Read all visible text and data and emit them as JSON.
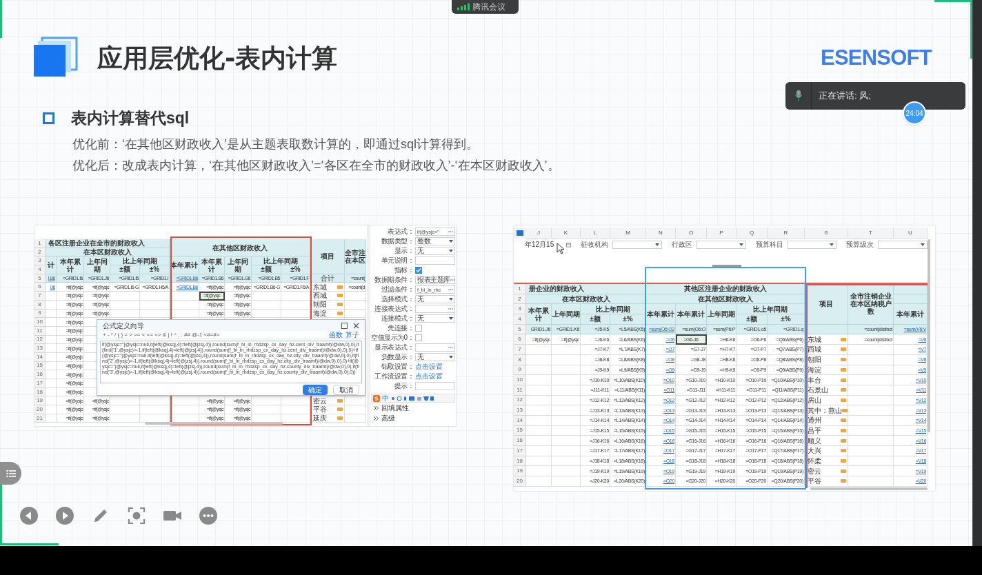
{
  "meeting_badge": {
    "title": "腾讯会议"
  },
  "slide": {
    "title": "应用层优化-表内计算",
    "brand": "ESENSOFT",
    "section": "表内计算替代sql",
    "paragraphs": [
      "优化前：‘在其他区财政收入’是从主题表取数计算的，即通过sql计算得到。",
      "优化后：改成表内计算，‘在其他区财政收入’=‘各区在全市的财政收入’-‘在本区财政收入’。"
    ]
  },
  "left_screenshot": {
    "row_numbers": [
      "1",
      "2",
      "3",
      "4",
      "5",
      "6",
      "7",
      "8",
      "9",
      "10",
      "11",
      "12",
      "13",
      "14",
      "15",
      "16",
      "17",
      "18",
      "19",
      "20",
      "21"
    ],
    "header_cells": [
      {
        "text": "各区注册企业在全市的财政收入"
      },
      {
        "text": "在本区财政收入"
      },
      {
        "text": "在其他区财政收入"
      },
      {
        "text": "项目"
      },
      {
        "lines": [
          "全市注",
          "在本区"
        ]
      },
      {
        "text": "计"
      },
      {
        "text": "本年累计"
      },
      {
        "text": "上年同期"
      },
      {
        "text": "比上年同期"
      },
      {
        "text": "±额"
      },
      {
        "text": "±%"
      },
      {
        "text": "本年累计"
      },
      {
        "text": "本年累计"
      },
      {
        "text": "上年同期"
      },
      {
        "text": "比上年同期"
      },
      {
        "text": "±额"
      },
      {
        "text": "±%"
      }
    ],
    "body_rows": [
      {
        "c1": {
          "text": "I.B6",
          "kind": "link"
        },
        "c2": "=GRID1.I6",
        "c3": "=GRID1.J6",
        "c4": "=GRID1.I5",
        "c5": "=GRID1.I",
        "c6": {
          "text": "=GRID1.B6",
          "kind": "link"
        },
        "c7": "=GRID1.B6",
        "c8": "=GRID1.G6",
        "c9": "=GRID1.B5",
        "c10": "=GRID1.F",
        "c11": "合计",
        "c12": "=count("
      },
      {
        "c1": {
          "text": "I.I6",
          "kind": "link"
        },
        "c2": "=if(@ysjc",
        "c3": "=if(@ysjc",
        "c4": "=GRID1.I6-G",
        "c5": "=GRID1.H5/A",
        "c6": {
          "text": "=GRID1.B6",
          "kind": "link"
        },
        "c7": "=if(@ysjc",
        "c8": "=if(@ysjc",
        "c9": "=GRID1.B6-G",
        "c10": "=GRID1.F6/A",
        "c11": "东城",
        "c12": "=count(d"
      },
      {
        "c2": "=if(@ysjc",
        "c3": "=if(@ysjc",
        "c7": {
          "text": "=if(@ysjc",
          "kind": "selected"
        },
        "c8": "=if(@ysjc",
        "c11": "西城"
      },
      {
        "c2": "=if(@ysjc",
        "c3": "=if(@ysjc",
        "c7": "=if(@ysjc",
        "c8": "=if(@ysjc",
        "c11": "朝阳"
      },
      {
        "c2": "=if(@ysjc",
        "c3": "=if(@ysjc",
        "c7": "=if(@ysjc",
        "c8": "=if(@ysjc",
        "c11": "海淀"
      },
      {
        "c2": "=if(@ysjc"
      },
      {
        "c2": "=if(@ysjc"
      },
      {
        "c2": "=if(@ysjc"
      },
      {
        "c2": "=if(@ysjc"
      },
      {
        "c2": "=if(@ysjc"
      },
      {
        "c2": "=if(@ysjc"
      },
      {
        "c2": "=if(@ysjc"
      },
      {
        "c2": "=if(@ysjc"
      },
      {
        "c2": "=if(@ysjc"
      },
      {
        "c2": "=if(@ysjc",
        "c3": "=if(@ysjc",
        "c7": "=if(@ysjc",
        "c8": "=if(@ysjc",
        "c11": "密云"
      },
      {
        "c2": "=if(@ysjc",
        "c3": "=if(@ysjc",
        "c7": "=if(@ysjc",
        "c8": "=if(@ysjc",
        "c11": "平谷"
      },
      {
        "c2": "=if(@ysjc",
        "c3": "=if(@ysjc",
        "c7": "=if(@ysjc",
        "c8": "=if(@ysjc",
        "c11": "延庆"
      }
    ],
    "dialog": {
      "title": "公式定义向导",
      "operators": "+ - * / ( ) = > >= < <= <> & | ! ^ , : ## @-1 <#=#>",
      "links": [
        "函数",
        "算子"
      ],
      "formula": "if(@ysjc=''|@ysjc=null,if(left(@ksqj,4)=left(@jzsj,4)),round(sum(f_bi_in_rhdzsp_cx_day_hz.cent_div_traamt)/@dw,0),0),if(find('1',@ysjc)>-1,if(left(@ksqj,4)=left(@jzsj,4)),round(sum(f_bi_in_rhdzsp_cx_day_hz.cent_div_traamt)/@dw,0),0),0)+if(@ysjc=''|@ysjc=null,if(left(@ksqj,4)=left(@jzsj,4)),round(sum(f_bi_in_rhdzsp_cx_day_hz.city_div_traamt)/@dw,0),0),if(find('2',@ysjc)>-1,if(left(@ksqj,4)=left(@jzsj,4)),round(sum(f_bi_in_rhdzsp_cx_day_hz.city_div_traamt)/@dw,0),0),0)+if(@ysjc=''|@ysjc=null,if(left(@ksqj,4)=left(@jzsj,4)),round(sum(f_bi_in_rhdzsp_cx_day_hz.county_div_traamt)/@dw,0),0),if(find('3',@ysjc)>-1,if(left(@ksqj,4)=left(@jzsj,4)),round(sum(f_bi_in_rhdzsp_cx_day_hz.county_div_traamt)/@dw,0),0),0))",
      "buttons": [
        {
          "label": "确定",
          "primary": true
        },
        {
          "label": "取消",
          "primary": false
        }
      ]
    },
    "properties": [
      {
        "label": "表达式：",
        "kind": "ellipsis",
        "value": "if(@ysjc=''"
      },
      {
        "label": "数据类型：",
        "kind": "select",
        "value": "整数"
      },
      {
        "label": "显示：",
        "kind": "select",
        "value": "无"
      },
      {
        "label": "单元说明：",
        "kind": "text"
      },
      {
        "label": "指标：",
        "kind": "checkbox",
        "checked": true
      },
      {
        "label": "数据期条件：",
        "kind": "ellipsis",
        "value": "报表主题库"
      },
      {
        "label": "过滤条件：",
        "kind": "ellipsis",
        "value": "f_bi_in_rhc"
      },
      {
        "label": "选择模式：",
        "kind": "select",
        "value": "无"
      },
      {
        "label": "连接表达式：",
        "kind": "ellipsis"
      },
      {
        "label": "连接模式：",
        "kind": "select",
        "value": "无"
      },
      {
        "label": "先连接：",
        "kind": "checkbox",
        "checked": false
      },
      {
        "label": "空值显示为0：",
        "kind": "checkbox",
        "checked": false
      },
      {
        "label": "显示表达式：",
        "kind": "ellipsis"
      },
      {
        "label": "负数显示：",
        "kind": "select",
        "value": "无"
      },
      {
        "label": "钻取设置：",
        "kind": "link",
        "value": "点击设置"
      },
      {
        "label": "工作流设置：",
        "kind": "link",
        "value": "点击设置"
      },
      {
        "label": "提示：",
        "kind": "text"
      }
    ],
    "ime_mode": "中",
    "sections": [
      "回填属性",
      "高级"
    ]
  },
  "right_screenshot": {
    "column_letters": [
      "J",
      "K",
      "L",
      "M",
      "N",
      "O",
      "P",
      "Q",
      "R",
      "S",
      "T",
      "U"
    ],
    "filters": [
      {
        "kind": "date",
        "value": "年12月15"
      },
      {
        "kind": "select",
        "label": "征收机构"
      },
      {
        "kind": "select",
        "label": "行政区"
      },
      {
        "kind": "select",
        "label": "预算科目"
      },
      {
        "kind": "select",
        "label": "预算级次"
      }
    ],
    "row_numbers": [
      "1",
      "2",
      "3",
      "4",
      "5",
      "6",
      "7",
      "8",
      "9",
      "10",
      "11",
      "12",
      "13",
      "14",
      "15",
      "16",
      "17",
      "18",
      "19",
      "20"
    ],
    "header_cells": [
      {
        "text": "册企业的财政收入"
      },
      {
        "text": "其他区注册企业的财政收入"
      },
      {
        "text": "在本区财政收入"
      },
      {
        "text": "在其他区财政收入"
      },
      {
        "text": "项目"
      },
      {
        "text": "全市注销企业在本区纳税户数"
      },
      {
        "text": "本年累计"
      },
      {
        "text": "上年同期"
      },
      {
        "text": "比上年同期"
      },
      {
        "text": "±额"
      },
      {
        "text": "±%"
      },
      {
        "text": "本年累计"
      },
      {
        "text": "本年累计"
      },
      {
        "text": "上年同期"
      },
      {
        "text": "比上年同期"
      },
      {
        "text": "±额"
      },
      {
        "text": "±%"
      },
      {
        "text": "本年累计"
      }
    ],
    "body_rows": [
      {
        "J": "GRID1.J6",
        "K": "=GRID1.K6",
        "L": "=J5-K5",
        "M": "=L5/ABS(K5)",
        "N": {
          "text": "=sum(O6:O2",
          "kind": "link"
        },
        "O": "=sum(O6:O",
        "P": "=sum(P6:P",
        "Q": "=GRID1.o5",
        "R": "=GRID1.q",
        "T": "=count(distinct",
        "U": {
          "text": "=sum(V6:V",
          "kind": "link"
        }
      },
      {
        "J": "=if(@ysjc",
        "K": "=if(@ysjc",
        "L": "=J6-K6",
        "M": "=L6/ABS(K6)",
        "N": {
          "text": "=O6",
          "kind": "link"
        },
        "O": {
          "text": "=G6-J6",
          "kind": "selected"
        },
        "P": "=H6-K6",
        "Q": "=O6-P6",
        "R": "=Q6/ABS(P6)",
        "S": "东城",
        "T": "=count(distinct",
        "U": {
          "text": "=V6",
          "kind": "link"
        }
      },
      {
        "L": "=J7-K7",
        "M": "=L7/ABS(K7)",
        "N": {
          "text": "=O7",
          "kind": "link"
        },
        "O": "=G7-J7",
        "P": "=H7-K7",
        "Q": "=O7-P7",
        "R": "=Q7/ABS(P7)",
        "S": "西城",
        "U": {
          "text": "=V7",
          "kind": "link"
        }
      },
      {
        "L": "=J8-K8",
        "M": "=L8/ABS(K8)",
        "N": {
          "text": "=O8",
          "kind": "link"
        },
        "O": "=G8-J8",
        "P": "=H8-K8",
        "Q": "=O8-P8",
        "R": "=Q8/ABS(P8)",
        "S": "朝阳",
        "U": {
          "text": "=V8",
          "kind": "link"
        }
      },
      {
        "L": "=J9-K9",
        "M": "=L9/ABS(K9)",
        "N": {
          "text": "=O9",
          "kind": "link"
        },
        "O": "=G9-J9",
        "P": "=H9-K9",
        "Q": "=O9-P9",
        "R": "=Q9/ABS(P9)",
        "S": "海淀",
        "U": {
          "text": "=V9",
          "kind": "link"
        }
      },
      {
        "L": "=J10-K10",
        "M": "=L10/ABS(K10)",
        "N": {
          "text": "=O10",
          "kind": "link"
        },
        "O": "=G10-J10",
        "P": "=H10-K10",
        "Q": "=O10-P10",
        "R": "=Q10/ABS(P10)",
        "S": "丰台",
        "U": {
          "text": "=V10",
          "kind": "link"
        }
      },
      {
        "L": "=J11-K11",
        "M": "=L11/ABS(K11)",
        "N": {
          "text": "=O11",
          "kind": "link"
        },
        "O": "=G11-J11",
        "P": "=H11-K11",
        "Q": "=O11-P11",
        "R": "=Q11/ABS(P11)",
        "S": "石景山",
        "U": {
          "text": "=V11",
          "kind": "link"
        }
      },
      {
        "L": "=J12-K12",
        "M": "=L12/ABS(K12)",
        "N": {
          "text": "=O12",
          "kind": "link"
        },
        "O": "=G12-J12",
        "P": "=H12-K12",
        "Q": "=O12-P12",
        "R": "=Q12/ABS(P12)",
        "S": "房山",
        "U": {
          "text": "=V12",
          "kind": "link"
        }
      },
      {
        "L": "=J13-K13",
        "M": "=L13/ABS(K13)",
        "N": {
          "text": "=O13",
          "kind": "link"
        },
        "O": "=G13-J13",
        "P": "=H13-K13",
        "Q": "=O13-P13",
        "R": "=Q13/ABS(P13)",
        "S": "其中：燕山",
        "U": {
          "text": "=V13",
          "kind": "link"
        }
      },
      {
        "L": "=J14-K14",
        "M": "=L14/ABS(K14)",
        "N": {
          "text": "=O14",
          "kind": "link"
        },
        "O": "=G14-J14",
        "P": "=H14-K14",
        "Q": "=O14-P14",
        "R": "=Q14/ABS(P14)",
        "S": "通州",
        "U": {
          "text": "=V14",
          "kind": "link"
        }
      },
      {
        "L": "=J15-K15",
        "M": "=L15/ABS(K15)",
        "N": {
          "text": "=O15",
          "kind": "link"
        },
        "O": "=G15-J15",
        "P": "=H15-K15",
        "Q": "=O15-P15",
        "R": "=Q15/ABS(P15)",
        "S": "昌平",
        "U": {
          "text": "=V15",
          "kind": "link"
        }
      },
      {
        "L": "=J16-K16",
        "M": "=L16/ABS(K16)",
        "N": {
          "text": "=O16",
          "kind": "link"
        },
        "O": "=G16-J16",
        "P": "=H16-K16",
        "Q": "=O16-P16",
        "R": "=Q16/ABS(P16)",
        "S": "顺义",
        "U": {
          "text": "=V16",
          "kind": "link"
        }
      },
      {
        "L": "=J17-K17",
        "M": "=L17/ABS(K17)",
        "N": {
          "text": "=O17",
          "kind": "link"
        },
        "O": "=G17-J17",
        "P": "=H17-K17",
        "Q": "=O17-P17",
        "R": "=Q17/ABS(P17)",
        "S": "大兴",
        "U": {
          "text": "=V17",
          "kind": "link"
        }
      },
      {
        "L": "=J18-K18",
        "M": "=L18/ABS(K18)",
        "N": {
          "text": "=O18",
          "kind": "link"
        },
        "O": "=G18-J18",
        "P": "=H18-K18",
        "Q": "=O18-P18",
        "R": "=Q18/ABS(P18)",
        "S": "怀柔",
        "U": {
          "text": "=V18",
          "kind": "link"
        }
      },
      {
        "L": "=J19-K19",
        "M": "=L19/ABS(K19)",
        "N": {
          "text": "=O19",
          "kind": "link"
        },
        "O": "=G19-J19",
        "P": "=H19-K19",
        "Q": "=O19-P19",
        "R": "=Q19/ABS(P19)",
        "S": "密云",
        "U": {
          "text": "=V19",
          "kind": "link"
        }
      },
      {
        "L": "=J20-K20",
        "M": "=L20/ABS(K20)",
        "N": {
          "text": "=O20",
          "kind": "link"
        },
        "O": "=G20-J20",
        "P": "=H20-K20",
        "Q": "=O20-P20",
        "R": "=Q20/ABS(P20)",
        "S": "平谷",
        "U": {
          "text": "=V20",
          "kind": "link"
        }
      }
    ]
  },
  "speaker": {
    "text": "正在讲话: 风;",
    "timer": "24:04"
  }
}
